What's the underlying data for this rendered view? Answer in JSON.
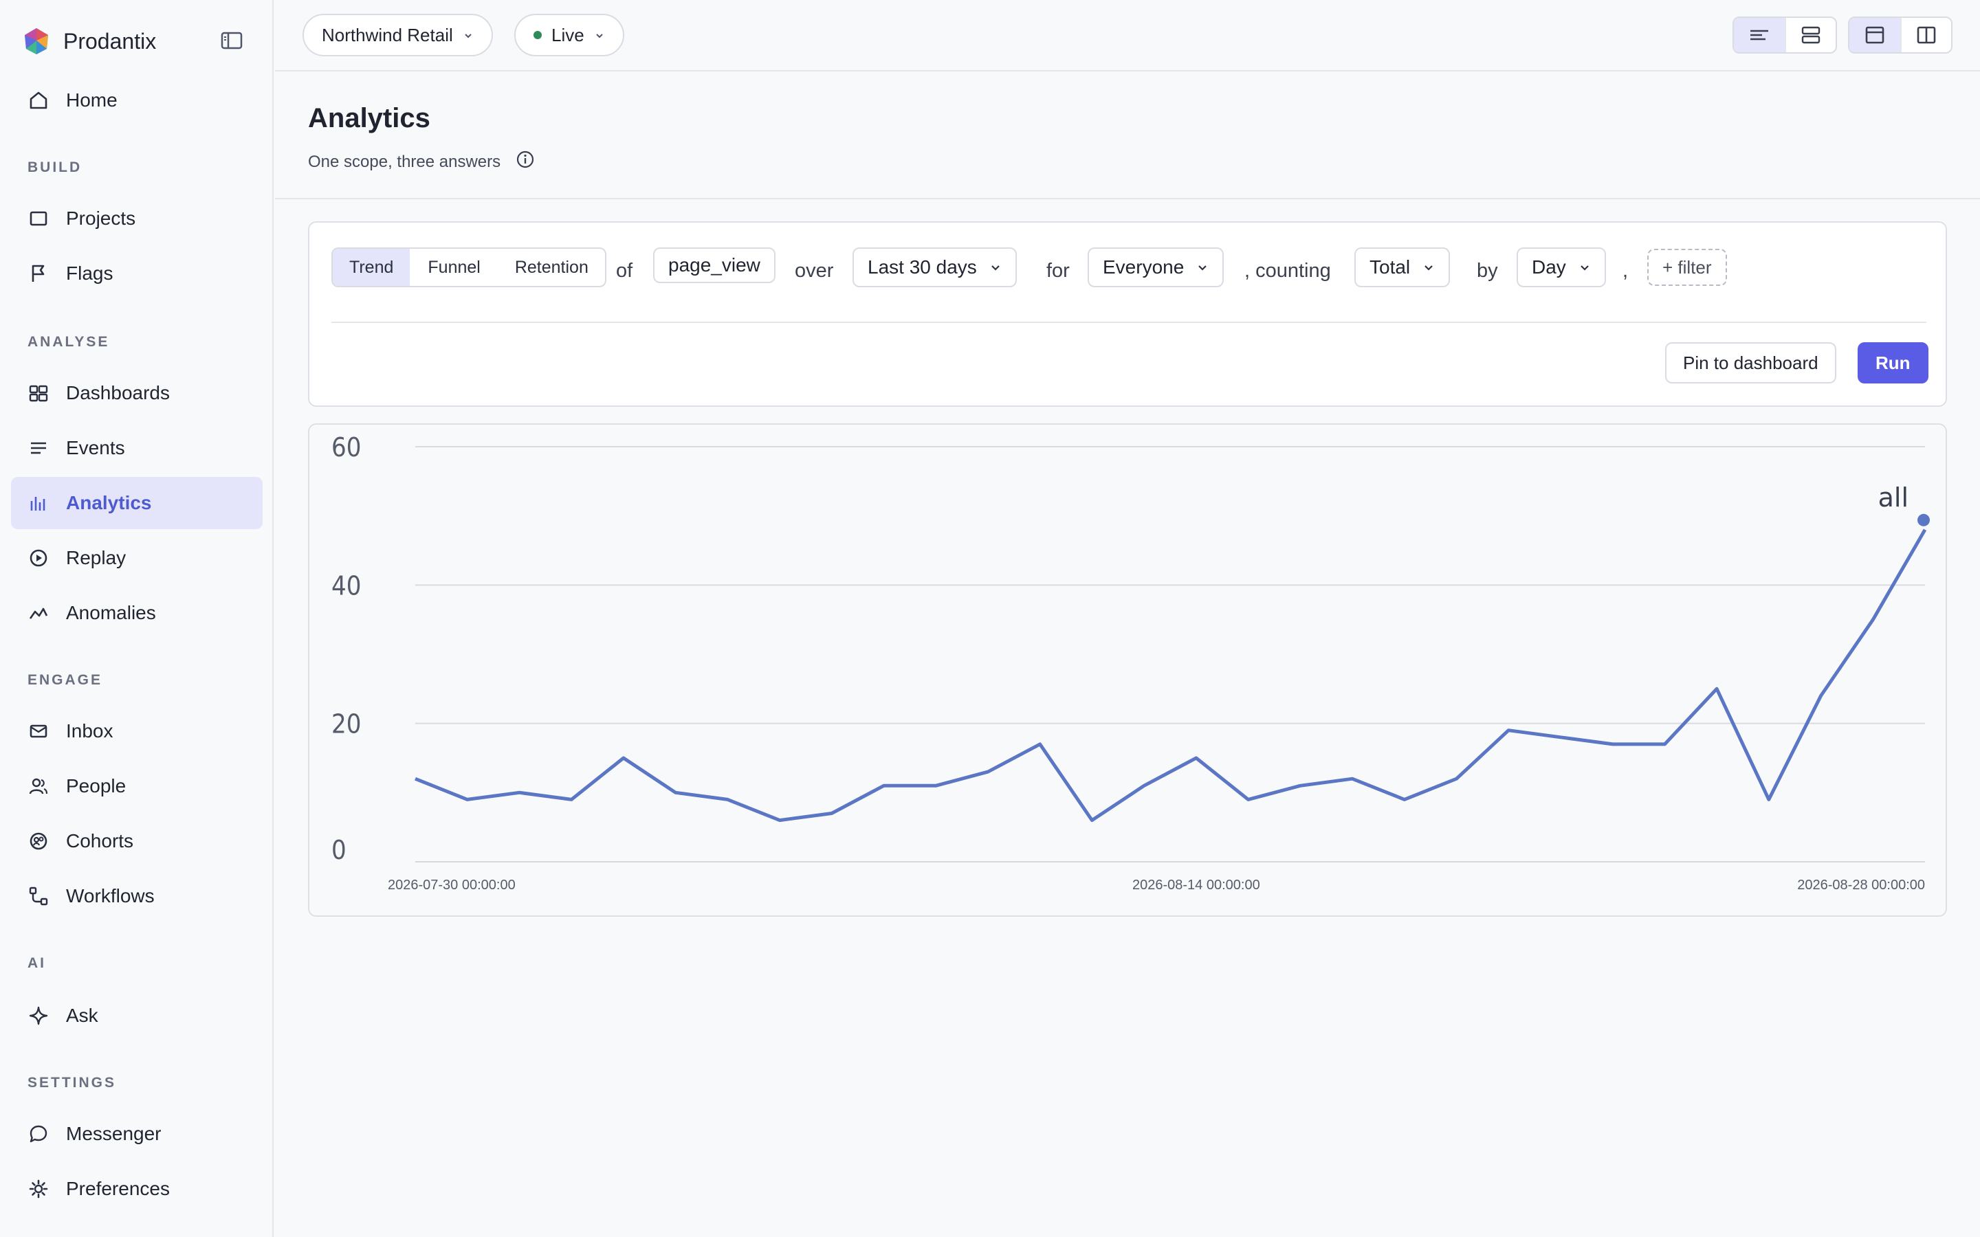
{
  "app": {
    "name": "Prodantix"
  },
  "sidebar": {
    "home": "Home",
    "sections": {
      "build": "BUILD",
      "analyse": "ANALYSE",
      "engage": "ENGAGE",
      "ai": "AI",
      "settings": "SETTINGS"
    },
    "items": {
      "projects": "Projects",
      "flags": "Flags",
      "dashboards": "Dashboards",
      "events": "Events",
      "analytics": "Analytics",
      "replay": "Replay",
      "anomalies": "Anomalies",
      "inbox": "Inbox",
      "people": "People",
      "cohorts": "Cohorts",
      "workflows": "Workflows",
      "ask": "Ask",
      "messenger": "Messenger",
      "preferences": "Preferences"
    },
    "active": "analytics"
  },
  "topbar": {
    "workspace": "Northwind Retail",
    "environment": "Live"
  },
  "header": {
    "title": "Analytics",
    "subtitle": "One scope, three answers"
  },
  "builder": {
    "tabs": [
      "Trend",
      "Funnel",
      "Retention"
    ],
    "active_tab": "Trend",
    "word_of": "of",
    "event": "page_view",
    "word_over": "over",
    "range": "Last 30 days",
    "word_for": "for",
    "audience": "Everyone",
    "word_counting": ", counting",
    "measure": "Total",
    "word_by": "by",
    "interval": "Day",
    "word_comma": ",",
    "add_filter": "+ filter",
    "pin_label": "Pin to dashboard",
    "run_label": "Run"
  },
  "colors": {
    "accent": "#5b5ce6",
    "series": "#5b76c4",
    "live": "#2f8a5a"
  },
  "chart_data": {
    "type": "line",
    "series": [
      {
        "name": "all",
        "values": [
          12,
          9,
          10,
          9,
          15,
          10,
          9,
          6,
          7,
          11,
          11,
          13,
          17,
          6,
          11,
          15,
          9,
          11,
          12,
          9,
          12,
          19,
          18,
          17,
          17,
          25,
          9,
          24,
          35,
          48
        ]
      }
    ],
    "x": [
      "2026-07-30",
      "2026-07-31",
      "2026-08-01",
      "2026-08-02",
      "2026-08-03",
      "2026-08-04",
      "2026-08-05",
      "2026-08-06",
      "2026-08-07",
      "2026-08-08",
      "2026-08-09",
      "2026-08-10",
      "2026-08-11",
      "2026-08-12",
      "2026-08-13",
      "2026-08-14",
      "2026-08-15",
      "2026-08-16",
      "2026-08-17",
      "2026-08-18",
      "2026-08-19",
      "2026-08-20",
      "2026-08-21",
      "2026-08-22",
      "2026-08-23",
      "2026-08-24",
      "2026-08-25",
      "2026-08-26",
      "2026-08-27",
      "2026-08-28"
    ],
    "x_tick_labels": [
      "2026-07-30 00:00:00",
      "2026-08-14 00:00:00",
      "2026-08-28 00:00:00"
    ],
    "y_ticks": [
      0,
      20,
      40,
      60
    ],
    "ylim": [
      0,
      60
    ],
    "grid": true,
    "legend": "end-of-line label"
  }
}
